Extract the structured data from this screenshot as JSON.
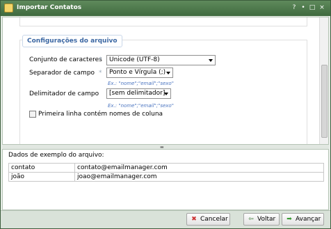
{
  "window": {
    "title": "Importar Contatos",
    "controls": [
      "?",
      "•",
      "□",
      "×"
    ]
  },
  "section": {
    "legend": "Configurações do arquivo"
  },
  "form": {
    "charset": {
      "label": "Conjunto de caracteres",
      "required_mark": "*",
      "value": "Unicode (UTF-8)"
    },
    "separator": {
      "label": "Separador de campo",
      "required_mark": "*",
      "value": "Ponto e Vírgula (;)",
      "example": "Ex.: \"nome\";\"email\";\"sexo\""
    },
    "delimiter": {
      "label": "Delimitador de campo",
      "value": "[sem delimitador]",
      "example": "Ex.: \"nome\";\"email\";\"sexo\""
    },
    "first_line": {
      "label": "Primeira linha contém nomes de coluna",
      "checked": false
    }
  },
  "sample": {
    "caption": "Dados de exemplo do arquivo:",
    "rows": [
      [
        "contato",
        "contato@emailmanager.com"
      ],
      [
        "joão",
        "joao@emailmanager.com"
      ]
    ]
  },
  "buttons": {
    "cancel": "Cancelar",
    "back": "Voltar",
    "next": "Avançar"
  },
  "icons": {
    "window": "contacts-icon",
    "cancel": "close-icon",
    "back": "arrow-left-icon",
    "next": "arrow-right-icon"
  },
  "colors": {
    "titlebar": "#4f7a4c",
    "legend": "#3b67a3",
    "example": "#4a74c0"
  }
}
